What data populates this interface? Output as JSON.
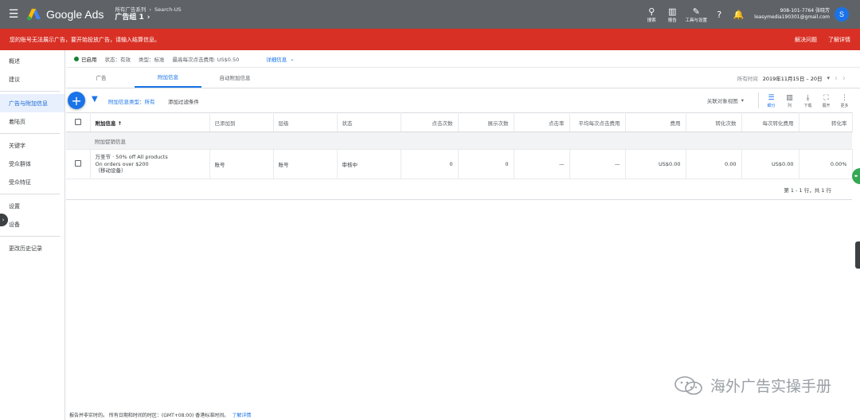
{
  "topbar": {
    "menu_icon": "menu-icon",
    "app_name": "Google Ads",
    "breadcrumb_top_1": "所有广告系列",
    "breadcrumb_top_2": "Search-US",
    "title": "广告组 1",
    "tools": [
      {
        "label": "搜索",
        "icon": "search-icon"
      },
      {
        "label": "报告",
        "icon": "reports-icon"
      },
      {
        "label": "工具与设置",
        "icon": "wrench-icon"
      }
    ],
    "account_line1": "908-101-7764 张晓芳",
    "account_line2": "leasymedia190301@gmail.com",
    "avatar_letter": "S"
  },
  "alert": {
    "message": "您的账号无法展示广告，要开始投放广告，请输入结算信息。",
    "action_fix": "解决问题",
    "action_learn": "了解详情"
  },
  "sidebar": {
    "items": [
      {
        "label": "概述"
      },
      {
        "label": "建议"
      },
      {
        "label": "广告与附加信息",
        "active": true
      },
      {
        "label": "着陆页"
      },
      {
        "label": "关键字"
      },
      {
        "label": "受众群体"
      },
      {
        "label": "受众特征"
      },
      {
        "label": "设置"
      },
      {
        "label": "设备"
      },
      {
        "label": "更改历史记录"
      }
    ]
  },
  "status": {
    "enabled": "已启用",
    "status_text": "状态：有效",
    "type_text": "类型：标准",
    "cpc_text": "最高每次点击费用: US$0.50",
    "details_link": "详细信息"
  },
  "tabs": [
    {
      "label": "广告"
    },
    {
      "label": "附加信息",
      "active": true
    },
    {
      "label": "自动附加信息"
    }
  ],
  "daterange": {
    "label": "所有时间",
    "value": "2019年11月15日 – 20日"
  },
  "toolbar": {
    "filter_chip": "附加信息类型：所有",
    "add_filter": "添加过滤条件",
    "view_select": "关联对象视图",
    "buttons": [
      {
        "label": "细分",
        "icon": "segment-icon"
      },
      {
        "label": "列",
        "icon": "columns-icon"
      },
      {
        "label": "下载",
        "icon": "download-icon"
      },
      {
        "label": "展开",
        "icon": "expand-icon"
      },
      {
        "label": "更多",
        "icon": "more-icon"
      }
    ]
  },
  "table": {
    "headers": [
      "附加信息",
      "已添加到",
      "层级",
      "状态",
      "点击次数",
      "展示次数",
      "点击率",
      "平均每次点击费用",
      "费用",
      "转化次数",
      "每次转化费用",
      "转化率"
    ],
    "group_label": "附加促销信息",
    "rows": [
      {
        "ext_line1": "万圣节 · 50% off All products",
        "ext_line2": "On orders over $200",
        "ext_line3": "（移动设备）",
        "added_to": "账号",
        "level": "账号",
        "status": "审核中",
        "clicks": "0",
        "impressions": "0",
        "ctr": "—",
        "avg_cpc": "—",
        "cost": "US$0.00",
        "conversions": "0.00",
        "cost_per_conv": "US$0.00",
        "conv_rate": "0.00%"
      }
    ],
    "pagination": "第 1 - 1 行，共 1 行"
  },
  "footer": {
    "line": "报告并非实时的。 所有日期和时间的时区：(GMT+08:00) 香港标准时间。",
    "link": "了解详情"
  },
  "watermark": {
    "text": "海外广告实操手册",
    "icon": "wechat-icon"
  },
  "colors": {
    "topbar": "#5f6368",
    "alert": "#d93025",
    "accent": "#1a73e8",
    "enabled": "#188038"
  }
}
